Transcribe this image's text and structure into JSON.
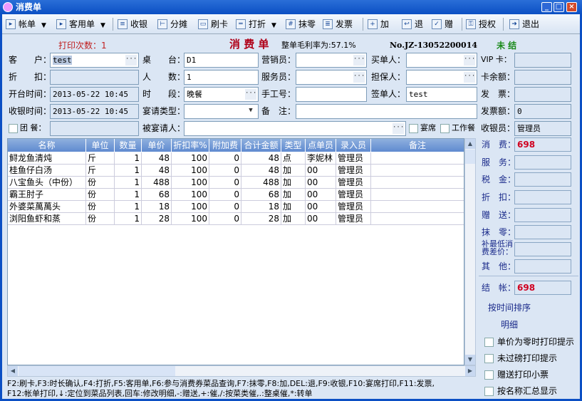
{
  "window": {
    "title": "消费单"
  },
  "toolbar": [
    {
      "id": "bill",
      "label": "帐单",
      "icon": "▸",
      "dd": true
    },
    {
      "id": "guest-bill",
      "label": "客用单",
      "icon": "▸",
      "dd": true
    },
    {
      "id": "checkout",
      "label": "收银",
      "icon": "≡"
    },
    {
      "id": "split",
      "label": "分摊",
      "icon": "⊢"
    },
    {
      "id": "swipe-card",
      "label": "刷卡",
      "icon": "▭"
    },
    {
      "id": "discount",
      "label": "打折",
      "icon": "═",
      "dd": true
    },
    {
      "id": "round-off",
      "label": "抹零",
      "icon": "#"
    },
    {
      "id": "invoice",
      "label": "发票",
      "icon": "≣"
    },
    {
      "id": "add",
      "label": "加",
      "icon": "+"
    },
    {
      "id": "return",
      "label": "退",
      "icon": "↩"
    },
    {
      "id": "gift",
      "label": "赠",
      "icon": "✓"
    },
    {
      "id": "authorize",
      "label": "授权",
      "icon": "⚿"
    },
    {
      "id": "exit",
      "label": "退出",
      "icon": "➜"
    }
  ],
  "info": {
    "print_count": "打印次数：1",
    "title": "消 费 单",
    "margin": "整单毛利率为:57.1%",
    "bill_no": "No.JZ-13052200014",
    "status": "未  结"
  },
  "form": {
    "customer": {
      "label": "客　　户：",
      "value": "test"
    },
    "discount": {
      "label": "折　　扣：",
      "value": ""
    },
    "open_time": {
      "label": "开台时间：",
      "value": "2013-05-22 10:45"
    },
    "checkout_time": {
      "label": "收银时间：",
      "value": "2013-05-22 10:45"
    },
    "group_meal": {
      "label": "团 餐：",
      "value": ""
    },
    "table": {
      "label": "桌　　台：",
      "value": "D1"
    },
    "people": {
      "label": "人　　数：",
      "value": "1"
    },
    "period": {
      "label": "时　　段：",
      "value": "晚餐"
    },
    "banquet_type": {
      "label": "宴请类型：",
      "value": ""
    },
    "invitee": {
      "label": "被宴请人：",
      "value": ""
    },
    "sales": {
      "label": "营销员：",
      "value": ""
    },
    "waiter": {
      "label": "服务员：",
      "value": ""
    },
    "manual_no": {
      "label": "手工号：",
      "value": ""
    },
    "remark": {
      "label": "备　注：",
      "value": ""
    },
    "buyer": {
      "label": "买单人：",
      "value": ""
    },
    "guarantor": {
      "label": "担保人：",
      "value": ""
    },
    "signer": {
      "label": "签单人：",
      "value": "test"
    },
    "banquet": {
      "label": "宴席"
    },
    "work_meal": {
      "label": "工作餐"
    },
    "vip": {
      "label": "VIP 卡：",
      "value": ""
    },
    "card_balance": {
      "label": "卡余额：",
      "value": ""
    },
    "invoice": {
      "label": "发　票：",
      "value": ""
    },
    "invoice_amount": {
      "label": "发票额：",
      "value": "0"
    },
    "cashier": {
      "label": "收银员：",
      "value": "管理员"
    }
  },
  "table": {
    "columns": [
      "名称",
      "单位",
      "数量",
      "单价",
      "折扣率%",
      "附加费",
      "合计金额",
      "类型",
      "点单员",
      "录入员",
      "备注"
    ],
    "rows": [
      [
        "鲟龙鱼清炖",
        "斤",
        "1",
        "48",
        "100",
        "0",
        "48",
        "点",
        "李妮林",
        "管理员",
        ""
      ],
      [
        "桂鱼仔白汤",
        "斤",
        "1",
        "48",
        "100",
        "0",
        "48",
        "加",
        "00",
        "管理员",
        ""
      ],
      [
        "八宝鱼头（中份）",
        "份",
        "1",
        "488",
        "100",
        "0",
        "488",
        "加",
        "00",
        "管理员",
        ""
      ],
      [
        "霸王肘子",
        "份",
        "1",
        "68",
        "100",
        "0",
        "68",
        "加",
        "00",
        "管理员",
        ""
      ],
      [
        "外婆菜萬萬头",
        "份",
        "1",
        "18",
        "100",
        "0",
        "18",
        "加",
        "00",
        "管理员",
        ""
      ],
      [
        "浏阳鱼虾和蒸",
        "份",
        "1",
        "28",
        "100",
        "0",
        "28",
        "加",
        "00",
        "管理员",
        ""
      ]
    ]
  },
  "hotkeys": [
    "F2:刷卡,F3:时长确认,F4:打折,F5:客用单,F6:参与消费券菜品查询,F7:抹零,F8:加,DEL:退,F9:收银,F10:宴席打印,F11:发票,",
    "F12:帐单打印,↓:定位到菜品列表,回车:修改明细,-:赠送,+:催,/:按菜类催,.:整桌催,*:转单"
  ],
  "summary": [
    {
      "label": "消　费：",
      "value": "698"
    },
    {
      "label": "服　务：",
      "value": ""
    },
    {
      "label": "税　金：",
      "value": ""
    },
    {
      "label": "折　扣：",
      "value": ""
    },
    {
      "label": "赠　送：",
      "value": ""
    },
    {
      "label": "抹　零：",
      "value": ""
    },
    {
      "label": "补最低消费差价：",
      "value": ""
    },
    {
      "label": "其　他：",
      "value": ""
    }
  ],
  "total": {
    "label": "结　帐：",
    "value": "698"
  },
  "links": {
    "sort_time": "按时间排序",
    "detail": "明细"
  },
  "options": [
    "单价为零时打印提示",
    "未过磅打印提示",
    "赠送打印小票",
    "按名称汇总显示"
  ],
  "colors": {
    "title": "#0b4fc4",
    "header": "#6f95d6",
    "red": "#d00020",
    "green": "#1a8a1a"
  }
}
